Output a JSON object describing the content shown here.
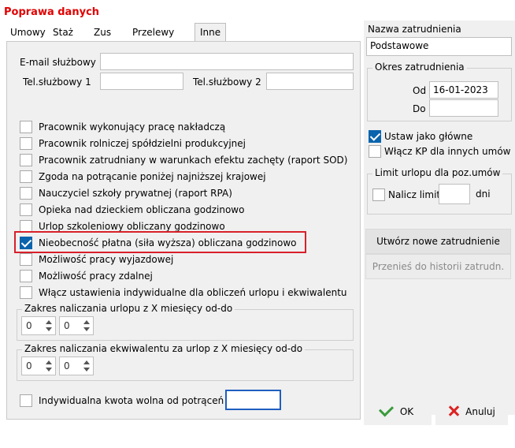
{
  "window": {
    "title": "Poprawa danych"
  },
  "tabs": [
    "Umowy",
    "Staż",
    "Zus",
    "Przelewy",
    "Inne"
  ],
  "fields": {
    "email_label": "E-mail służbowy",
    "email_value": "",
    "tel1_label": "Tel.służbowy 1",
    "tel1_value": "",
    "tel2_label": "Tel.służbowy 2",
    "tel2_value": ""
  },
  "checkboxes": [
    {
      "label": "Pracownik wykonujący pracę nakładczą",
      "checked": false
    },
    {
      "label": "Pracownik rolniczej spółdzielni produkcyjnej",
      "checked": false
    },
    {
      "label": "Pracownik zatrudniany w warunkach efektu zachęty (raport SOD)",
      "checked": false
    },
    {
      "label": "Zgoda na potrącanie poniżej najniższej krajowej",
      "checked": false
    },
    {
      "label": "Nauczyciel szkoły prywatnej (raport RPA)",
      "checked": false
    },
    {
      "label": "Opieka nad dzieckiem obliczana godzinowo",
      "checked": false
    },
    {
      "label": "Urlop szkoleniowy obliczany godzinowo",
      "checked": false
    },
    {
      "label": "Nieobecność płatna (siła wyższa) obliczana godzinowo",
      "checked": true
    },
    {
      "label": "Możliwość pracy wyjazdowej",
      "checked": false
    },
    {
      "label": "Możliwość pracy zdalnej",
      "checked": false
    },
    {
      "label": "Włącz ustawienia indywidualne dla obliczeń urlopu i ekwiwalentu",
      "checked": false
    }
  ],
  "urlop_range": {
    "label": "Zakres naliczania urlopu z X miesięcy od-do",
    "from": "0",
    "to": "0"
  },
  "ekwiwalent_range": {
    "label": "Zakres naliczania ekwiwalentu za urlop z X miesięcy od-do",
    "from": "0",
    "to": "0"
  },
  "kwota_wolna": {
    "label": "Indywidualna kwota wolna od potrąceń",
    "value": "",
    "checked": false
  },
  "right": {
    "nazwa_label": "Nazwa zatrudnienia",
    "nazwa_value": "Podstawowe",
    "okres_label": "Okres zatrudnienia",
    "od_label": "Od",
    "od_value": "16-01-2023",
    "do_label": "Do",
    "do_value": "",
    "ustaw_glowne": {
      "label": "Ustaw jako główne",
      "checked": true
    },
    "wlacz_kp": {
      "label": "Włącz KP dla innych umów",
      "checked": false
    },
    "limit_label": "Limit urlopu dla poz.umów",
    "nalicz_label": "Nalicz limit",
    "nalicz_checked": false,
    "nalicz_value": "",
    "dni_label": "dni",
    "utworz_button": "Utwórz nowe zatrudnienie",
    "przenies_button": "Przenieś do historii zatrudn."
  },
  "buttons": {
    "ok": "OK",
    "cancel": "Anuluj"
  },
  "colors": {
    "title": "#e00000",
    "highlight": "#d8202a",
    "check": "#0a64ad",
    "ok_icon": "#3a9b3a",
    "cancel_icon": "#dd2222"
  }
}
